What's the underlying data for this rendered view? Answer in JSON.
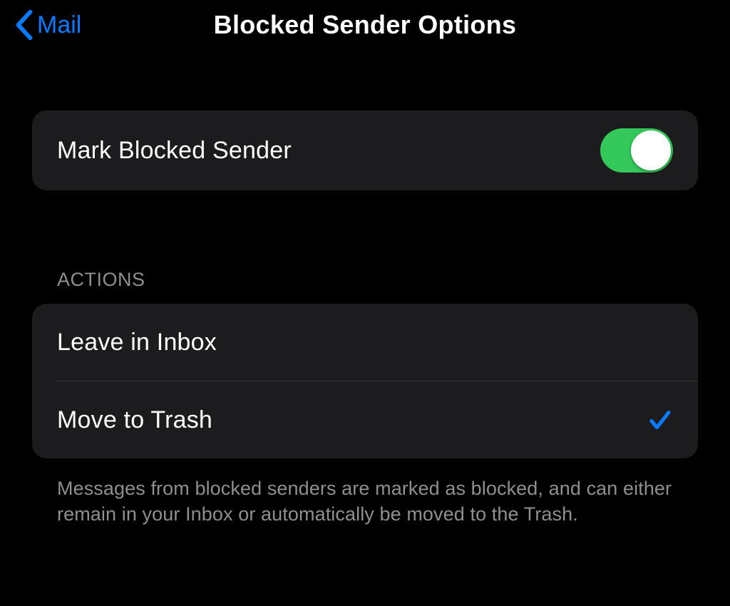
{
  "header": {
    "back_label": "Mail",
    "title": "Blocked Sender Options"
  },
  "toggle_row": {
    "label": "Mark Blocked Sender",
    "on": true
  },
  "actions": {
    "header": "ACTIONS",
    "options": [
      {
        "label": "Leave in Inbox",
        "selected": false
      },
      {
        "label": "Move to Trash",
        "selected": true
      }
    ],
    "footer": "Messages from blocked senders are marked as blocked, and can either remain in your Inbox or automatically be moved to the Trash."
  }
}
